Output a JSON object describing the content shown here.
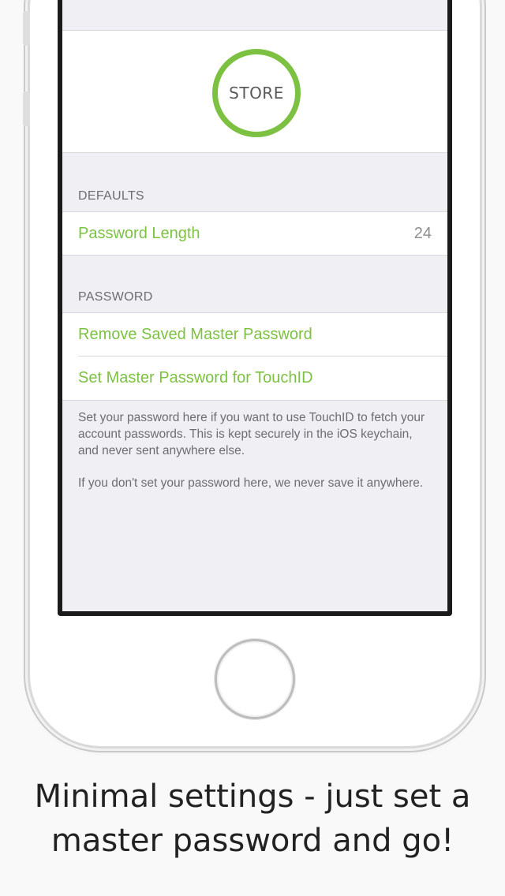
{
  "app": {
    "logo_text": "STORE",
    "accent_color": "#7dc142"
  },
  "sections": {
    "defaults": {
      "header": "DEFAULTS",
      "rows": [
        {
          "label": "Password Length",
          "value": "24"
        }
      ]
    },
    "password": {
      "header": "PASSWORD",
      "rows": [
        {
          "label": "Remove Saved Master Password"
        },
        {
          "label": "Set Master Password for TouchID"
        }
      ],
      "footer": [
        "Set your password here if you want to use TouchID to fetch your account passwords. This is kept securely in the iOS keychain, and never sent anywhere else.",
        "If you don't set your password here, we never save it anywhere."
      ]
    }
  },
  "caption": {
    "line1": "Minimal settings - just set a",
    "line2": "master password and go!"
  },
  "icons": {
    "home_button": "home-button-icon",
    "logo": "store-logo-ring"
  }
}
